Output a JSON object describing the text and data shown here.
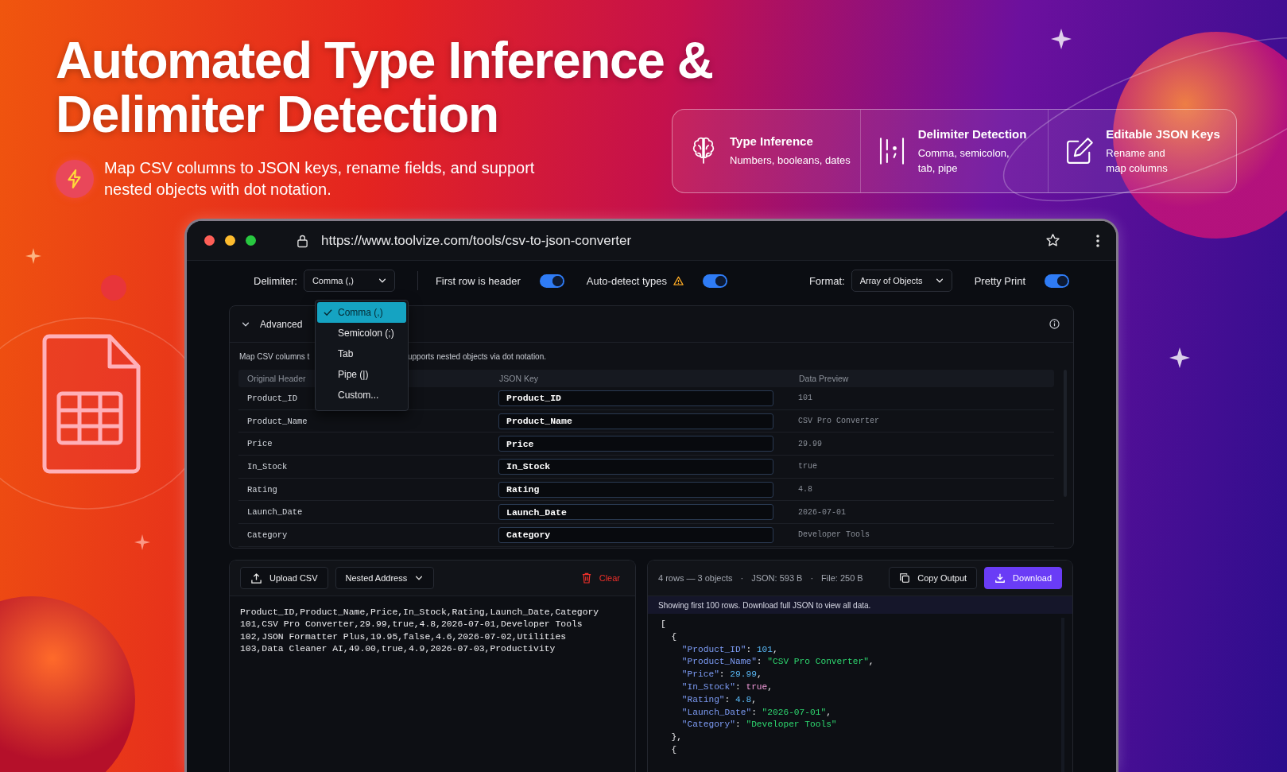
{
  "headline_lines": [
    "Automated Type Inference &",
    "Delimiter Detection"
  ],
  "subtitle": "Map CSV columns to JSON keys, rename fields, and support nested objects with dot notation.",
  "features": [
    {
      "title": "Type Inference",
      "text": "Numbers, booleans, dates"
    },
    {
      "title": "Delimiter Detection",
      "text": "Comma, semicolon, tab, pipe"
    },
    {
      "title": "Editable JSON Keys",
      "text": "Rename and map columns"
    }
  ],
  "browser": {
    "url": "https://www.toolvize.com/tools/csv-to-json-converter"
  },
  "toolbar": {
    "left": [
      {
        "kind": "select",
        "label": "Delimiter:",
        "value": "Comma (,)"
      },
      {
        "kind": "toggle",
        "label": "First row is header",
        "on": true,
        "warning": false
      },
      {
        "kind": "toggle",
        "label": "Auto-detect types",
        "on": true,
        "warning": true
      }
    ],
    "right": [
      {
        "kind": "select",
        "label": "Format:",
        "value": "Array of Objects"
      },
      {
        "kind": "toggle",
        "label": "Pretty Print",
        "on": true,
        "warning": false
      }
    ]
  },
  "delimiter_menu": [
    {
      "label": "Comma (,)",
      "selected": true
    },
    {
      "label": "Semicolon (;)",
      "selected": false
    },
    {
      "label": "Tab",
      "selected": false
    },
    {
      "label": "Pipe (|)",
      "selected": false
    },
    {
      "label": "Custom...",
      "selected": false
    }
  ],
  "advanced": {
    "label": "Advanced",
    "expanded": true,
    "hint_parts": [
      "Map CSV columns t",
      "upports nested objects via dot notation."
    ],
    "columns": [
      "Original Header",
      "JSON Key",
      "Data Preview"
    ],
    "rows": [
      {
        "original": "Product_ID",
        "key": "Product_ID",
        "preview": "101"
      },
      {
        "original": "Product_Name",
        "key": "Product_Name",
        "preview": "CSV Pro Converter"
      },
      {
        "original": "Price",
        "key": "Price",
        "preview": "29.99"
      },
      {
        "original": "In_Stock",
        "key": "In_Stock",
        "preview": "true"
      },
      {
        "original": "Rating",
        "key": "Rating",
        "preview": "4.8"
      },
      {
        "original": "Launch_Date",
        "key": "Launch_Date",
        "preview": "2026-07-01"
      },
      {
        "original": "Category",
        "key": "Category",
        "preview": "Developer Tools"
      }
    ]
  },
  "input_panel": {
    "upload_button": "Upload CSV",
    "sample_select": "Nested Address",
    "clear_button": "Clear",
    "csv_lines": [
      "Product_ID,Product_Name,Price,In_Stock,Rating,Launch_Date,Category",
      "101,CSV Pro Converter,29.99,true,4.8,2026-07-01,Developer Tools",
      "102,JSON Formatter Plus,19.95,false,4.6,2026-07-02,Utilities",
      "103,Data Cleaner AI,49.00,true,4.9,2026-07-03,Productivity"
    ]
  },
  "output_panel": {
    "stats": [
      "4 rows — 3 objects",
      "·",
      "JSON: 593 B",
      "·",
      "File: 250 B"
    ],
    "copy_button": "Copy Output",
    "download_button": "Download",
    "notice": "Showing first 100 rows. Download full JSON to view all data.",
    "json_lines": [
      "[",
      "  {",
      "    \"Product_ID\": 101,",
      "    \"Product_Name\": \"CSV Pro Converter\",",
      "    \"Price\": 29.99,",
      "    \"In_Stock\": true,",
      "    \"Rating\": 4.8,",
      "    \"Launch_Date\": \"2026-07-01\",",
      "    \"Category\": \"Developer Tools\"",
      "  },",
      "  {"
    ]
  }
}
